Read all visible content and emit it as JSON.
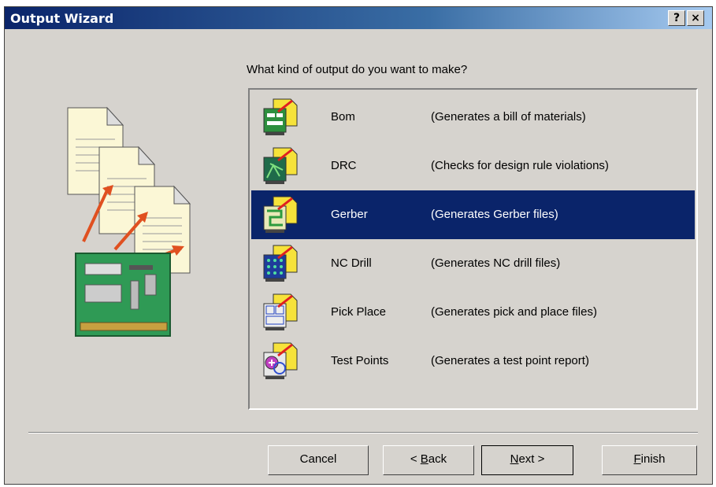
{
  "window": {
    "title": "Output Wizard",
    "help_glyph": "?",
    "close_glyph": "×"
  },
  "prompt": "What kind of output do you want to make?",
  "items": [
    {
      "name": "Bom",
      "desc": "(Generates a bill of materials)",
      "icon": "bom-icon",
      "selected": false
    },
    {
      "name": "DRC",
      "desc": "(Checks for design rule violations)",
      "icon": "drc-icon",
      "selected": false
    },
    {
      "name": "Gerber",
      "desc": "(Generates Gerber files)",
      "icon": "gerber-icon",
      "selected": true
    },
    {
      "name": "NC Drill",
      "desc": "(Generates NC drill files)",
      "icon": "nc-drill-icon",
      "selected": false
    },
    {
      "name": "Pick Place",
      "desc": "(Generates pick and place files)",
      "icon": "pick-place-icon",
      "selected": false
    },
    {
      "name": "Test Points",
      "desc": "(Generates a test point report)",
      "icon": "test-points-icon",
      "selected": false
    }
  ],
  "buttons": {
    "cancel": "Cancel",
    "back_pre": "< ",
    "back_mn": "B",
    "back_post": "ack",
    "next_mn": "N",
    "next_post": "ext >",
    "finish_mn": "F",
    "finish_post": "inish"
  },
  "colors": {
    "face": "#d6d3ce",
    "selection": "#0a246a",
    "title_start": "#0a246a",
    "title_end": "#a6caf0"
  }
}
